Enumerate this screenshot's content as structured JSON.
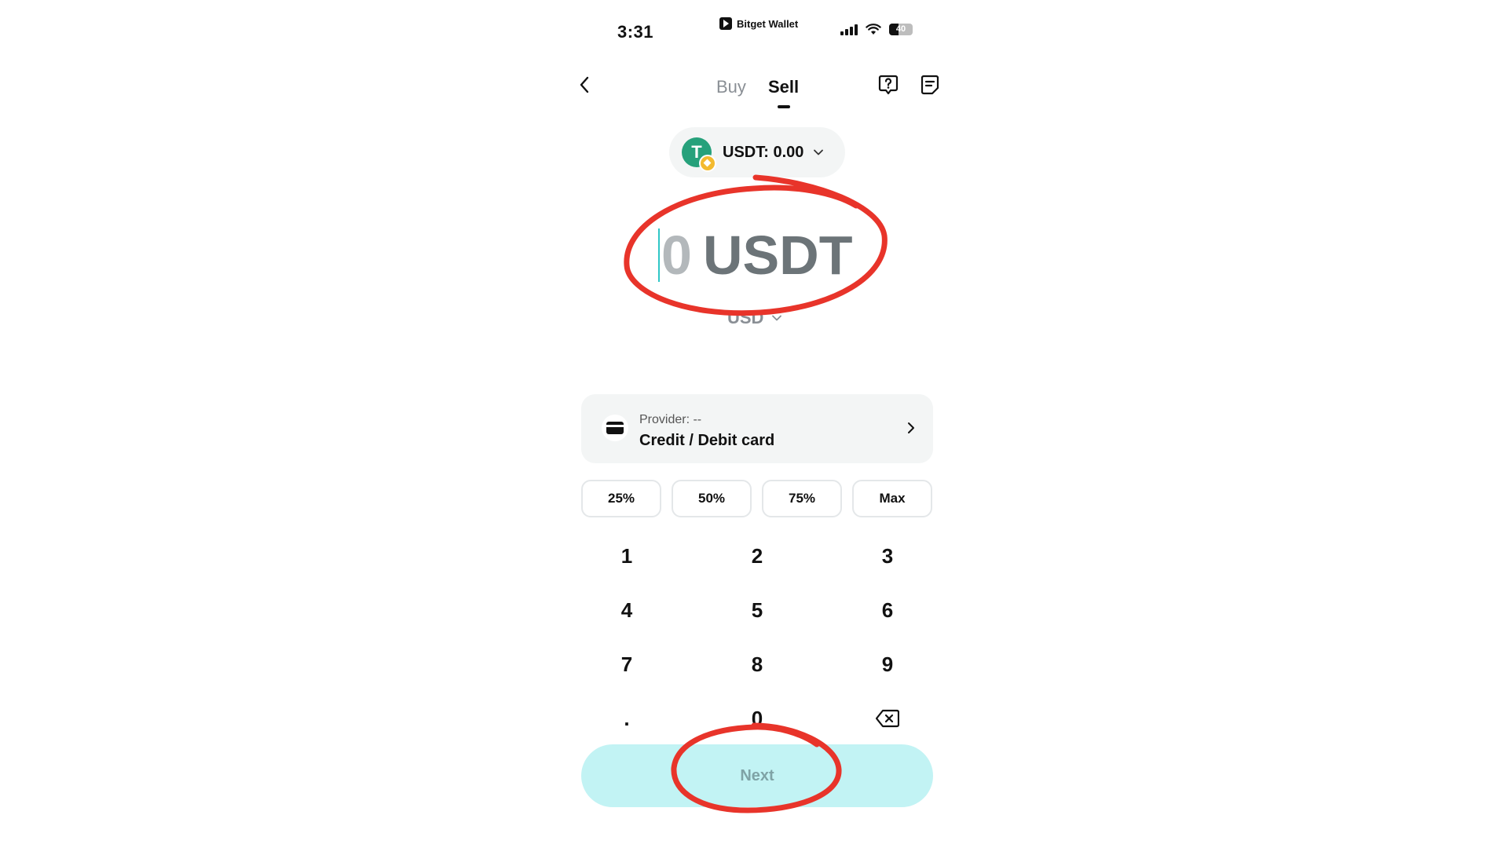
{
  "status_bar": {
    "time": "3:31",
    "app_name": "Bitget Wallet",
    "battery": "40"
  },
  "header": {
    "tabs": [
      {
        "label": "Buy",
        "active": false
      },
      {
        "label": "Sell",
        "active": true
      }
    ],
    "icons": [
      "back-icon",
      "help-icon",
      "orders-icon"
    ]
  },
  "token_selector": {
    "label": "USDT: 0.00",
    "logo_letter": "T"
  },
  "amount": {
    "value": "0",
    "unit": "USDT",
    "fiat_currency": "USD"
  },
  "provider": {
    "label": "Provider: --",
    "method": "Credit / Debit card"
  },
  "percent_buttons": [
    "25%",
    "50%",
    "75%",
    "Max"
  ],
  "keypad": [
    "1",
    "2",
    "3",
    "4",
    "5",
    "6",
    "7",
    "8",
    "9",
    ".",
    "0"
  ],
  "next_button": {
    "label": "Next"
  },
  "colors": {
    "accent_button": "#c2f3f4",
    "token_green": "#26a17b",
    "annotation_red": "#e8342a"
  }
}
